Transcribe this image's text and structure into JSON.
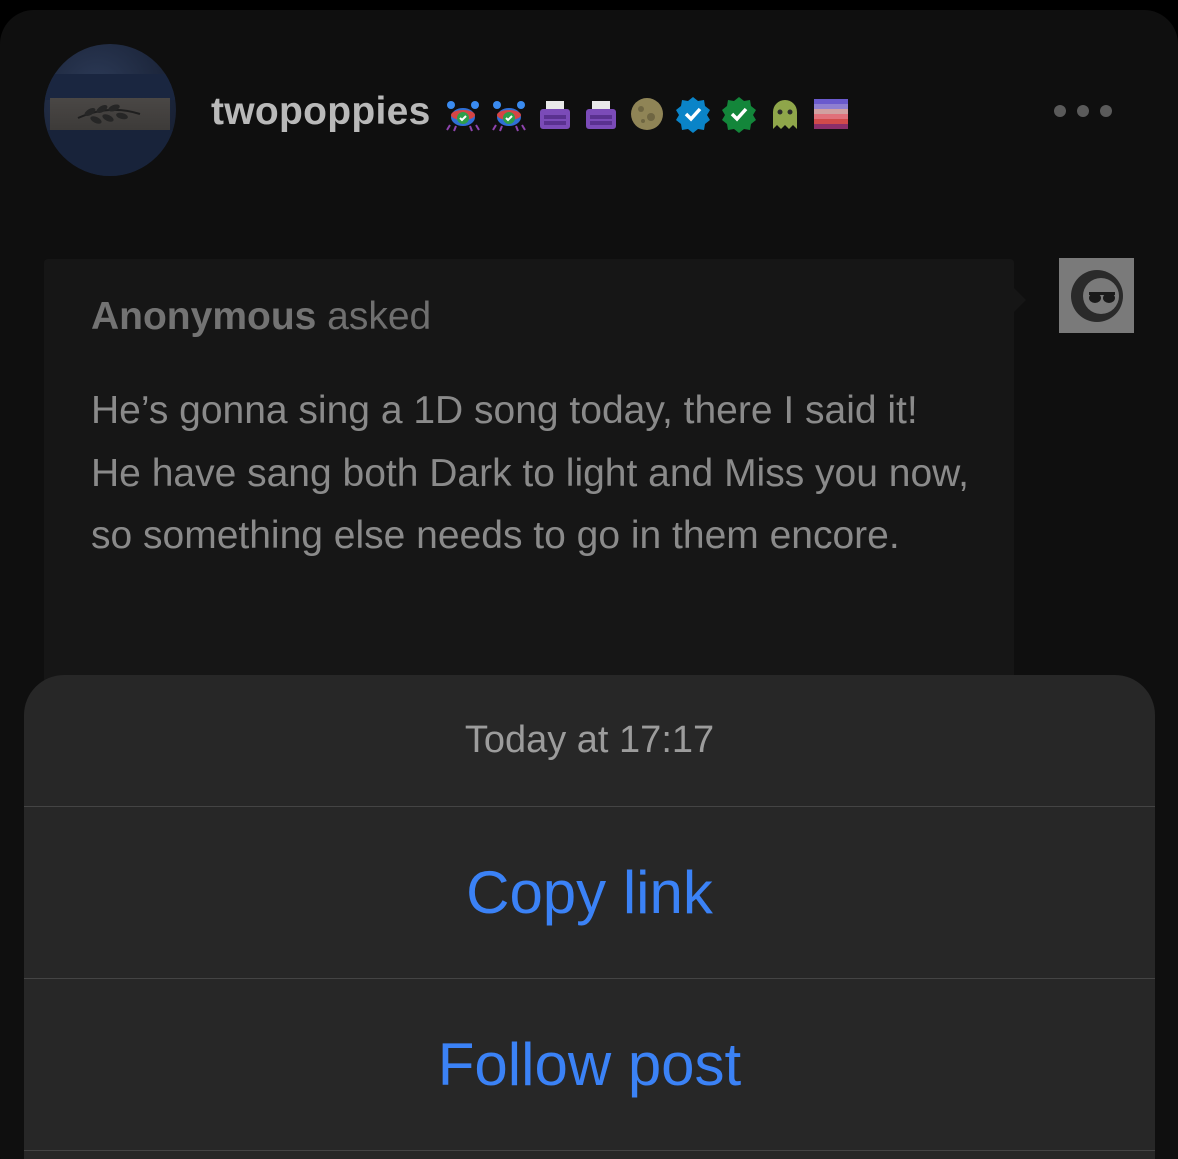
{
  "post": {
    "username": "twopoppies",
    "badges": [
      {
        "icon": "crab-verified-badge-icon"
      },
      {
        "icon": "crab-verified-badge-icon"
      },
      {
        "icon": "typewriter-badge-icon"
      },
      {
        "icon": "typewriter-badge-icon"
      },
      {
        "icon": "moon-badge-icon"
      },
      {
        "icon": "blue-checkmark-badge-icon"
      },
      {
        "icon": "green-checkmark-badge-icon"
      },
      {
        "icon": "ghost-badge-icon"
      },
      {
        "icon": "gradient-stripes-badge-icon"
      }
    ],
    "more_icon": "ellipsis-icon",
    "ask": {
      "asker_name": "Anonymous",
      "asker_suffix": " asked",
      "question": "He’s gonna sing a 1D song today, there I said it! He have sang both Dark to light and Miss you now, so something else needs to go in them encore.",
      "anon_avatar_icon": "sunglasses-face-icon"
    }
  },
  "action_sheet": {
    "timestamp": "Today at 17:17",
    "actions": [
      {
        "label": "Copy link"
      },
      {
        "label": "Follow post"
      }
    ]
  },
  "colors": {
    "accent": "#3b82f6",
    "background": "#0f0f0f",
    "sheet_background": "#272727"
  }
}
